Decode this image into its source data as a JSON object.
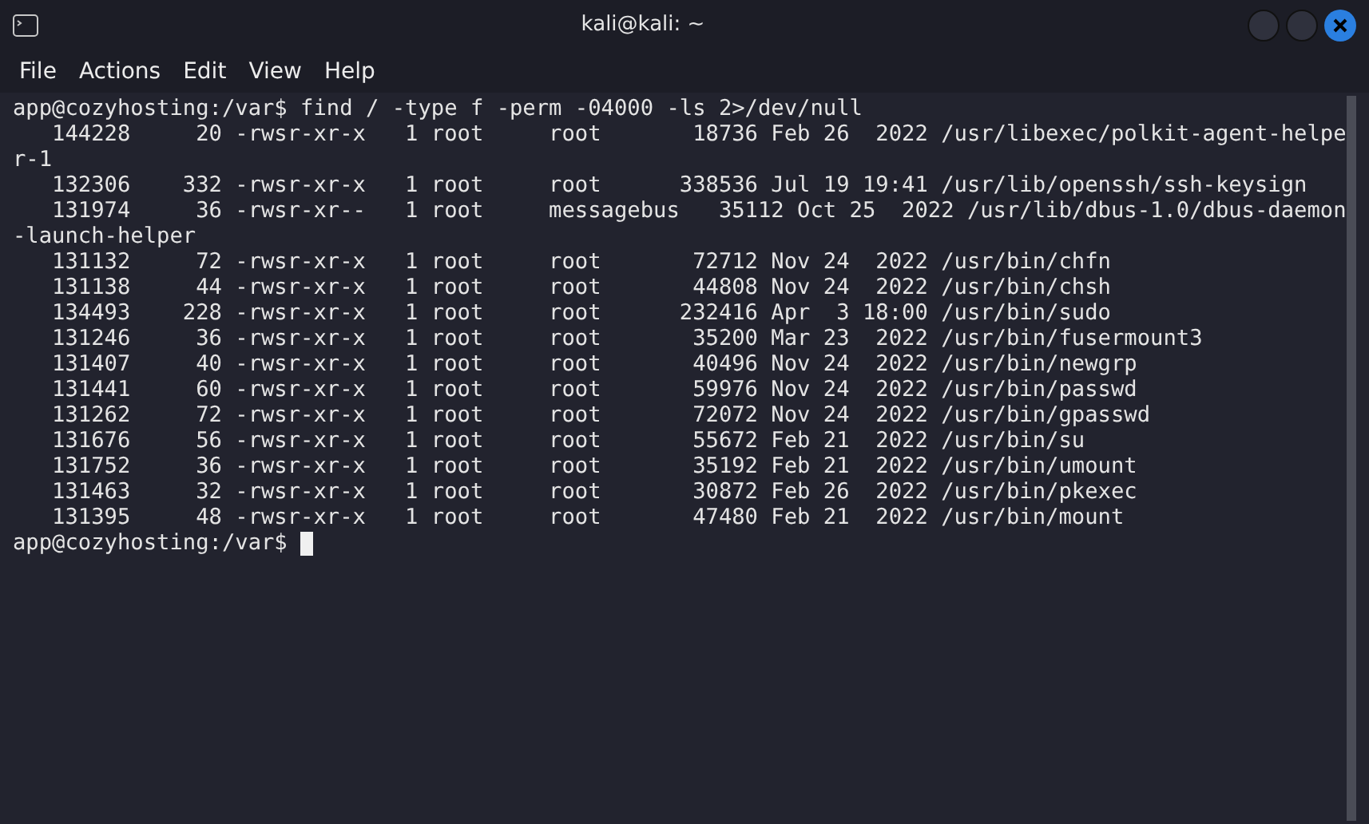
{
  "window": {
    "title": "kali@kali: ~"
  },
  "menu": [
    {
      "label": "File"
    },
    {
      "label": "Actions"
    },
    {
      "label": "Edit"
    },
    {
      "label": "View"
    },
    {
      "label": "Help"
    }
  ],
  "terminal": {
    "lines": [
      "app@cozyhosting:/var$ find / -type f -perm -04000 -ls 2>/dev/null",
      "   144228     20 -rwsr-xr-x   1 root     root       18736 Feb 26  2022 /usr/libexec/polkit-agent-helpe",
      "r-1",
      "   132306    332 -rwsr-xr-x   1 root     root      338536 Jul 19 19:41 /usr/lib/openssh/ssh-keysign",
      "   131974     36 -rwsr-xr--   1 root     messagebus   35112 Oct 25  2022 /usr/lib/dbus-1.0/dbus-daemon",
      "-launch-helper",
      "   131132     72 -rwsr-xr-x   1 root     root       72712 Nov 24  2022 /usr/bin/chfn",
      "   131138     44 -rwsr-xr-x   1 root     root       44808 Nov 24  2022 /usr/bin/chsh",
      "   134493    228 -rwsr-xr-x   1 root     root      232416 Apr  3 18:00 /usr/bin/sudo",
      "   131246     36 -rwsr-xr-x   1 root     root       35200 Mar 23  2022 /usr/bin/fusermount3",
      "   131407     40 -rwsr-xr-x   1 root     root       40496 Nov 24  2022 /usr/bin/newgrp",
      "   131441     60 -rwsr-xr-x   1 root     root       59976 Nov 24  2022 /usr/bin/passwd",
      "   131262     72 -rwsr-xr-x   1 root     root       72072 Nov 24  2022 /usr/bin/gpasswd",
      "   131676     56 -rwsr-xr-x   1 root     root       55672 Feb 21  2022 /usr/bin/su",
      "   131752     36 -rwsr-xr-x   1 root     root       35192 Feb 21  2022 /usr/bin/umount",
      "   131463     32 -rwsr-xr-x   1 root     root       30872 Feb 26  2022 /usr/bin/pkexec",
      "   131395     48 -rwsr-xr-x   1 root     root       47480 Feb 21  2022 /usr/bin/mount"
    ],
    "prompt": "app@cozyhosting:/var$",
    "cursor": true
  }
}
